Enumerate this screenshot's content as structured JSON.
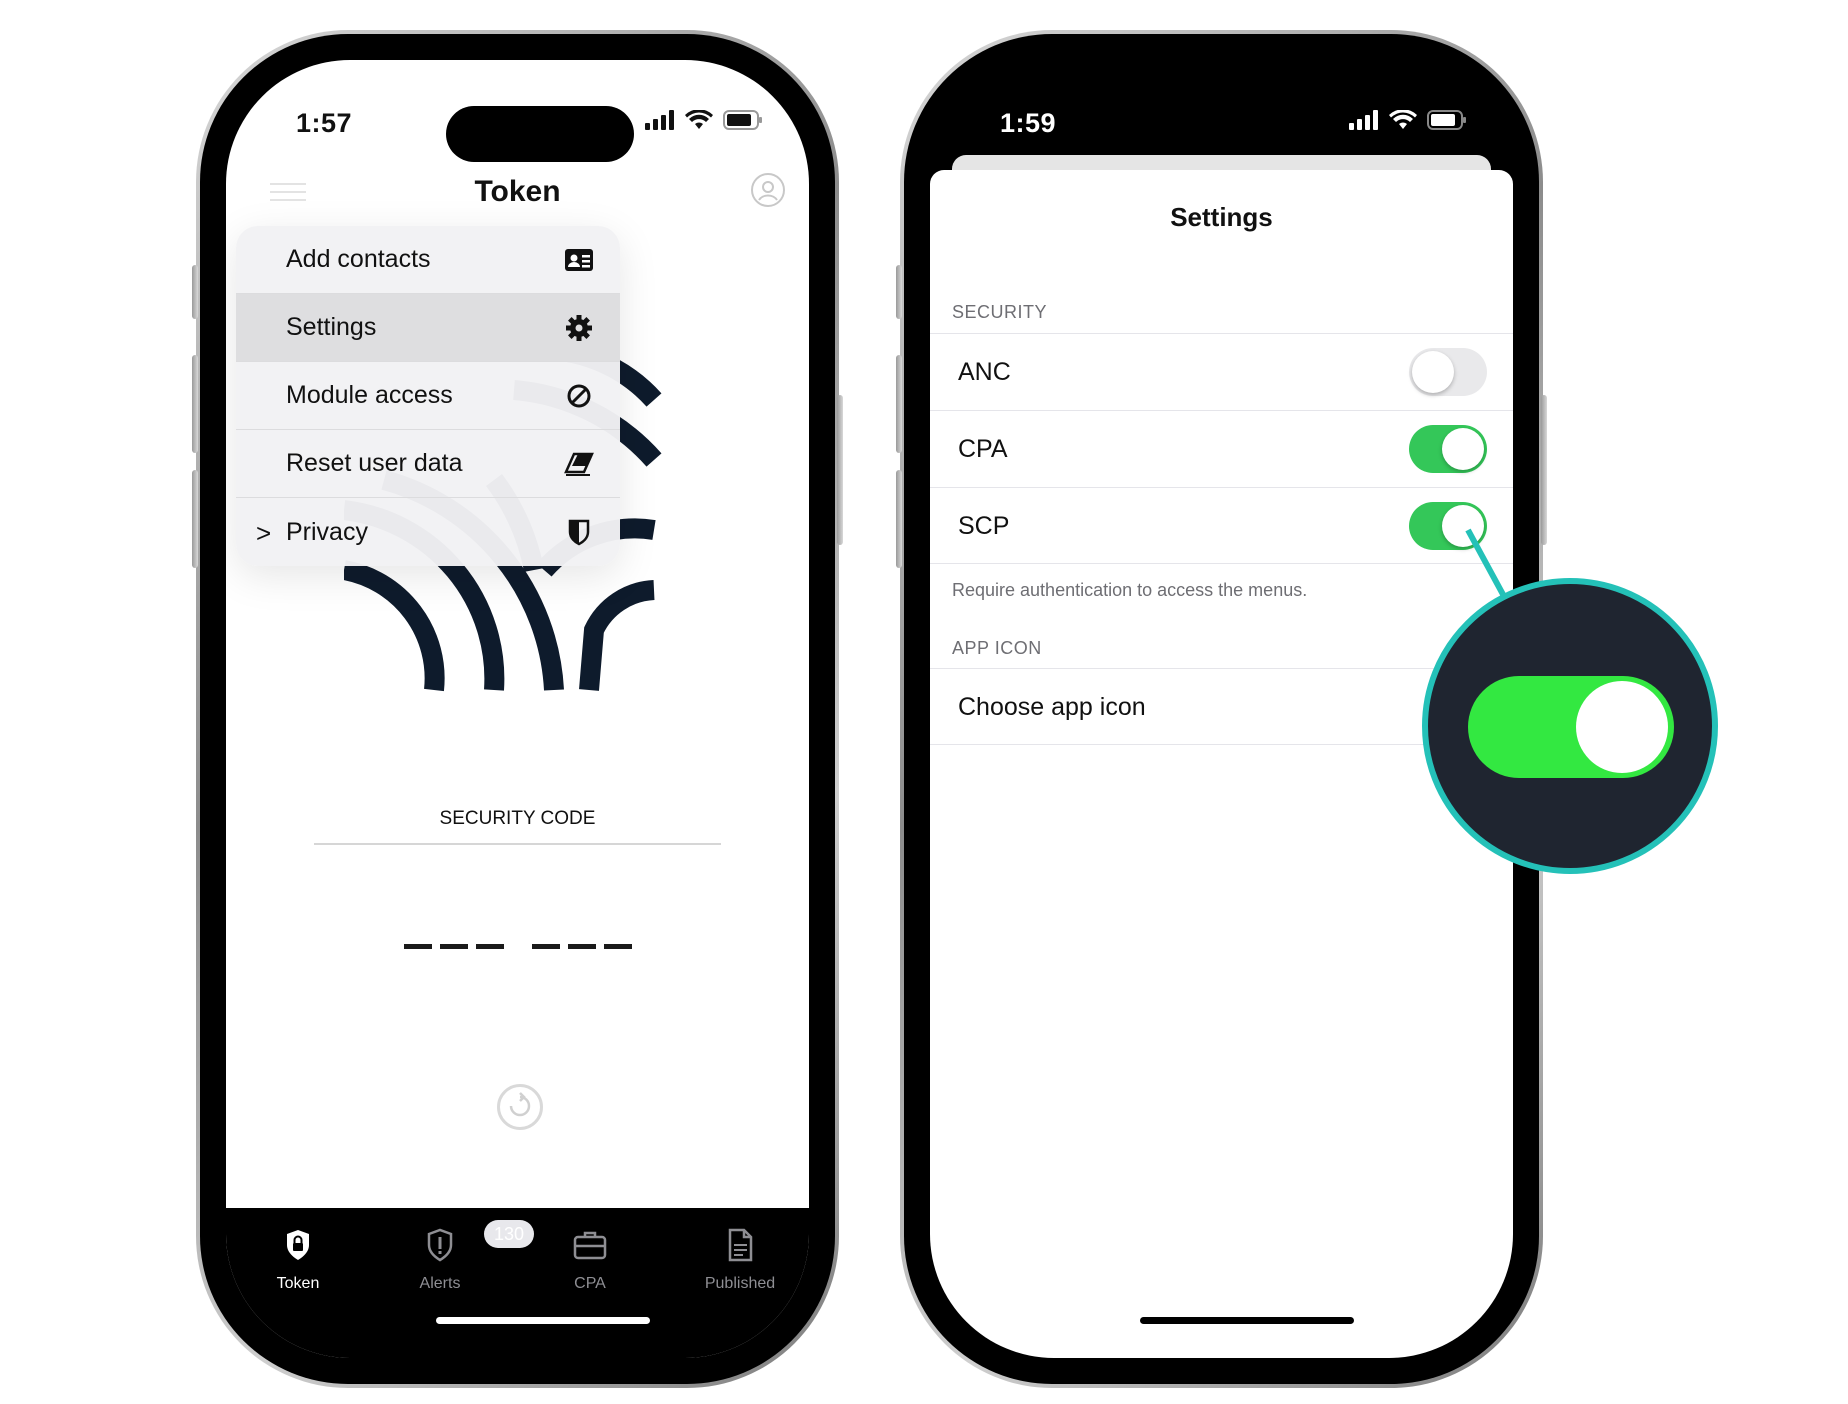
{
  "phone1": {
    "status": {
      "time": "1:57"
    },
    "header": {
      "title": "Token"
    },
    "menu": {
      "items": [
        {
          "label": "Add contacts",
          "icon": "contact-card-icon"
        },
        {
          "label": "Settings",
          "icon": "gear-icon",
          "active": true
        },
        {
          "label": "Module access",
          "icon": "prohibited-icon"
        },
        {
          "label": "Reset user data",
          "icon": "eraser-icon"
        },
        {
          "label": "Privacy",
          "icon": "shield-icon",
          "chevron": ">"
        }
      ]
    },
    "security": {
      "label": "SECURITY CODE"
    },
    "tabs": [
      {
        "label": "Token",
        "icon": "lock-shield-icon",
        "active": true
      },
      {
        "label": "Alerts",
        "icon": "alert-shield-icon",
        "badge": "130"
      },
      {
        "label": "CPA",
        "icon": "briefcase-icon"
      },
      {
        "label": "Published",
        "icon": "document-icon"
      }
    ],
    "colors": {
      "logo": "#0e1b2c",
      "tabbar": "#000000"
    }
  },
  "phone2": {
    "status": {
      "time": "1:59"
    },
    "sheet": {
      "title": "Settings"
    },
    "security_section": {
      "header": "SECURITY",
      "rows": [
        {
          "label": "ANC",
          "on": false
        },
        {
          "label": "CPA",
          "on": true
        },
        {
          "label": "SCP",
          "on": true
        }
      ],
      "footer": "Require authentication to access the menus."
    },
    "app_icon_section": {
      "header": "APP ICON",
      "row": {
        "label": "Choose app icon"
      }
    },
    "colors": {
      "toggle_on": "#34c759",
      "callout_ring": "#24c1b8",
      "callout_toggle": "#33e841"
    }
  }
}
